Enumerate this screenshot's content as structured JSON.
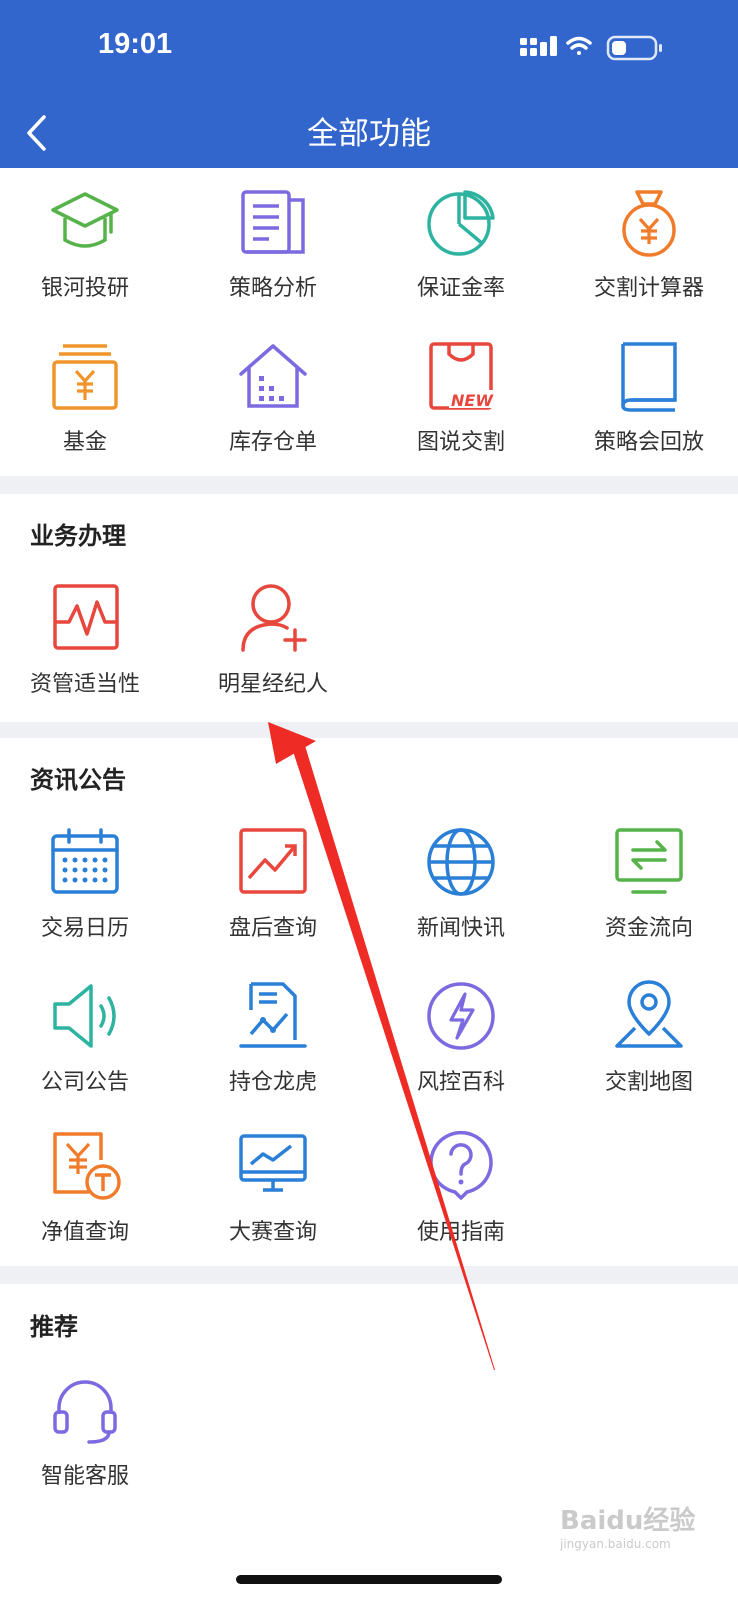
{
  "status_bar": {
    "time": "19:01"
  },
  "header": {
    "title": "全部功能"
  },
  "top_grid": [
    {
      "label": "银河投研",
      "icon": "graduation-cap-icon"
    },
    {
      "label": "策略分析",
      "icon": "document-icon"
    },
    {
      "label": "保证金率",
      "icon": "pie-chart-icon"
    },
    {
      "label": "交割计算器",
      "icon": "money-bag-icon"
    },
    {
      "label": "基金",
      "icon": "yen-box-icon"
    },
    {
      "label": "库存仓单",
      "icon": "warehouse-icon"
    },
    {
      "label": "图说交割",
      "icon": "shopping-bag-new-icon",
      "badge": "NEW"
    },
    {
      "label": "策略会回放",
      "icon": "book-icon"
    }
  ],
  "business": {
    "title": "业务办理",
    "items": [
      {
        "label": "资管适当性",
        "icon": "pulse-chart-icon"
      },
      {
        "label": "明星经纪人",
        "icon": "add-person-icon"
      }
    ]
  },
  "news": {
    "title": "资讯公告",
    "items": [
      {
        "label": "交易日历",
        "icon": "calendar-icon"
      },
      {
        "label": "盘后查询",
        "icon": "trend-chart-icon"
      },
      {
        "label": "新闻快讯",
        "icon": "globe-icon"
      },
      {
        "label": "资金流向",
        "icon": "transfer-monitor-icon"
      },
      {
        "label": "公司公告",
        "icon": "speaker-icon"
      },
      {
        "label": "持仓龙虎",
        "icon": "report-chart-icon"
      },
      {
        "label": "风控百科",
        "icon": "lightning-icon"
      },
      {
        "label": "交割地图",
        "icon": "map-pin-icon"
      },
      {
        "label": "净值查询",
        "icon": "yen-tag-icon"
      },
      {
        "label": "大赛查询",
        "icon": "monitor-chart-icon"
      },
      {
        "label": "使用指南",
        "icon": "question-icon"
      }
    ]
  },
  "recommend": {
    "title": "推荐",
    "items": [
      {
        "label": "智能客服",
        "icon": "headset-icon"
      }
    ]
  },
  "watermark": {
    "text": "Baidu经验",
    "sub": "jingyan.baidu.com"
  }
}
